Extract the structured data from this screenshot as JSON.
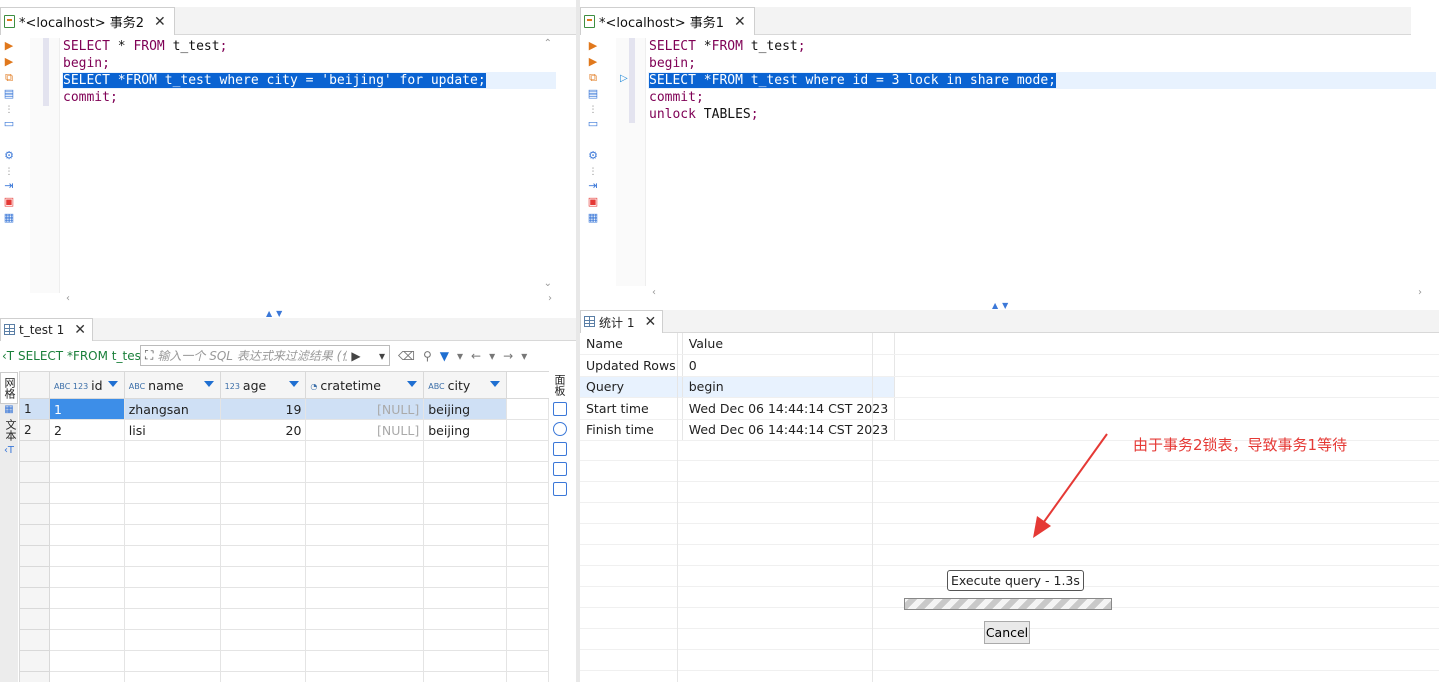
{
  "left": {
    "tab_title": "*<localhost> 事务2",
    "code_lines": [
      [
        {
          "t": "SELECT",
          "c": "kw"
        },
        {
          "t": " * ",
          "c": "plain"
        },
        {
          "t": "FROM",
          "c": "kw"
        },
        {
          "t": " t_test",
          "c": "plain"
        },
        {
          "t": ";",
          "c": "kw"
        }
      ],
      [
        {
          "t": "begin;",
          "c": "kw"
        }
      ],
      [
        {
          "t": "SELECT *FROM t_test where city = 'beijing' for update;",
          "c": "sel"
        }
      ],
      [
        {
          "t": "commit;",
          "c": "kw"
        }
      ]
    ],
    "result_tab": "t_test 1",
    "filter_query": "SELECT *FROM t_tes",
    "filter_placeholder": "输入一个 SQL 表达式来过滤结果 (位",
    "side_tabs": [
      "网格",
      "文本"
    ],
    "right_label": "面板",
    "columns": [
      {
        "type": "ABC 123",
        "name": "id"
      },
      {
        "type": "ABC",
        "name": "name"
      },
      {
        "type": "123",
        "name": "age"
      },
      {
        "type": "◔",
        "name": "cratetime"
      },
      {
        "type": "ABC",
        "name": "city"
      }
    ],
    "rows": [
      {
        "num": "1",
        "id": "1",
        "name": "zhangsan",
        "age": "19",
        "cratetime": "[NULL]",
        "city": "beijing"
      },
      {
        "num": "2",
        "id": "2",
        "name": "lisi",
        "age": "20",
        "cratetime": "[NULL]",
        "city": "beijing"
      }
    ]
  },
  "right": {
    "tab_title": "*<localhost> 事务1",
    "code_lines": [
      [
        {
          "t": "SELECT",
          "c": "kw"
        },
        {
          "t": " *",
          "c": "plain"
        },
        {
          "t": "FROM",
          "c": "kw"
        },
        {
          "t": " t_test",
          "c": "plain"
        },
        {
          "t": ";",
          "c": "kw"
        }
      ],
      [
        {
          "t": "begin;",
          "c": "kw"
        }
      ],
      [
        {
          "t": "SELECT *FROM t_test where id = 3 lock in share mode;",
          "c": "sel"
        }
      ],
      [
        {
          "t": "commit;",
          "c": "kw"
        }
      ],
      [
        {
          "t": "unlock",
          "c": "kw"
        },
        {
          "t": " TABLES",
          "c": "plain"
        },
        {
          "t": ";",
          "c": "kw"
        }
      ]
    ],
    "result_tab": "统计 1",
    "stats": [
      {
        "k": "Name",
        "v": "Value"
      },
      {
        "k": "Updated Rows",
        "v": "0"
      },
      {
        "k": "Query",
        "v": "begin"
      },
      {
        "k": "Start time",
        "v": "Wed Dec 06 14:44:14 CST 2023"
      },
      {
        "k": "Finish time",
        "v": "Wed Dec 06 14:44:14 CST 2023"
      }
    ],
    "annotation": "由于事务2锁表，导致事务1等待",
    "progress_label": "Execute query - 1.3s",
    "cancel_label": "Cancel"
  },
  "colors": {
    "selection": "#0a63d2",
    "keyword": "#7f0055",
    "annotation": "#e53935"
  }
}
